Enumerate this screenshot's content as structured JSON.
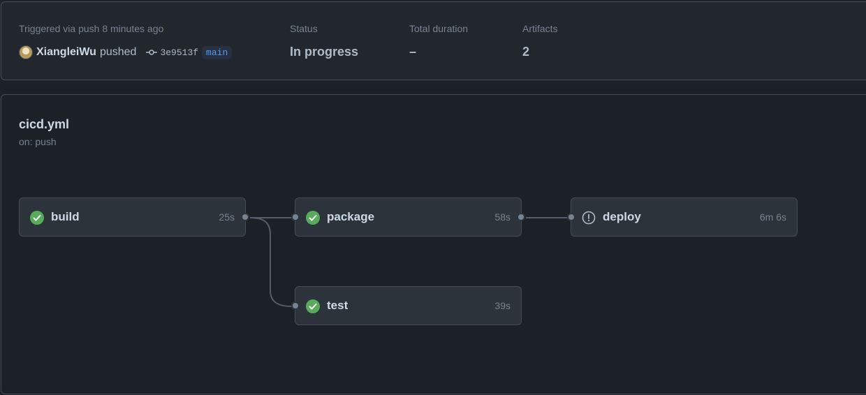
{
  "summary": {
    "trigger_label": "Triggered via push 8 minutes ago",
    "user": "XiangleiWu",
    "action": "pushed",
    "commit_sha": "3e9513f",
    "branch": "main",
    "status_label": "Status",
    "status_value": "In progress",
    "duration_label": "Total duration",
    "duration_value": "–",
    "artifacts_label": "Artifacts",
    "artifacts_value": "2"
  },
  "workflow": {
    "name": "cicd.yml",
    "trigger": "on: push",
    "jobs": [
      {
        "name": "build",
        "duration": "25s",
        "status": "success",
        "icon": "check-circle-icon"
      },
      {
        "name": "package",
        "duration": "58s",
        "status": "success",
        "icon": "check-circle-icon"
      },
      {
        "name": "deploy",
        "duration": "6m 6s",
        "status": "in-progress",
        "icon": "alert-circle-icon"
      },
      {
        "name": "test",
        "duration": "39s",
        "status": "success",
        "icon": "check-circle-icon"
      }
    ]
  },
  "colors": {
    "success": "#57ab5a",
    "neutral": "#768390",
    "branch": "#539bf5"
  }
}
